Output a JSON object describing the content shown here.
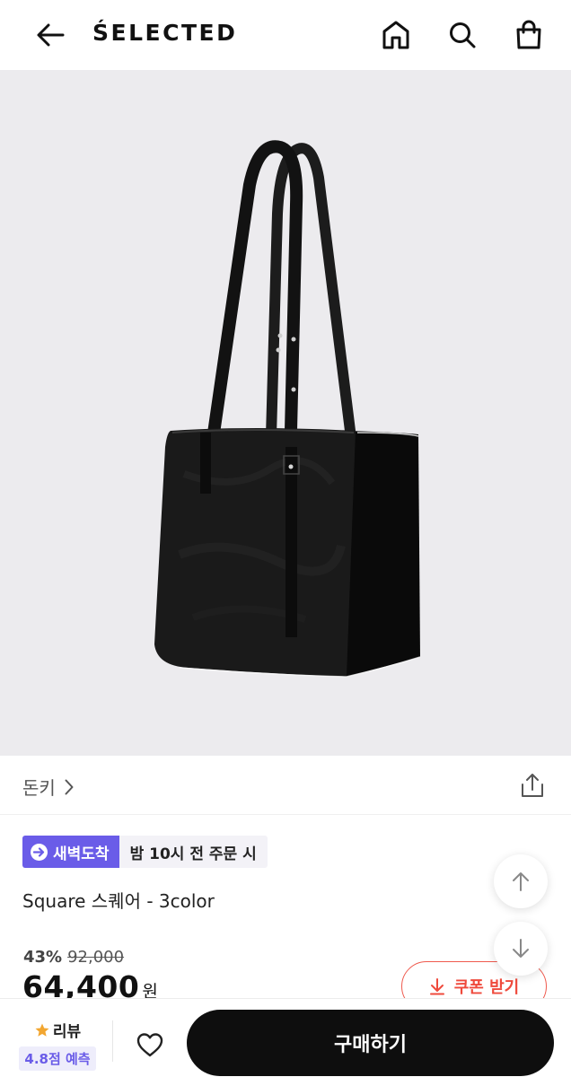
{
  "header": {
    "logo": "ŚELECTED",
    "icons": {
      "back": "arrow-left-icon",
      "home": "home-icon",
      "search": "search-icon",
      "bag": "shopping-bag-icon"
    }
  },
  "product": {
    "image": "black-leather-tote-bag",
    "brand": "돈키",
    "name": "Square 스퀘어 - 3color"
  },
  "delivery": {
    "badge": "새벽도착",
    "time": "밤 10시 전 주문 시"
  },
  "price": {
    "discount_rate": "43%",
    "original": "92,000",
    "sale": "64,400",
    "currency": "원"
  },
  "coupon": {
    "label": "쿠폰 받기"
  },
  "bottom": {
    "review_label": "리뷰",
    "rating": "4.8점 예측",
    "buy_label": "구매하기"
  },
  "colors": {
    "accent": "#6a5ce8",
    "coupon_red": "#ef4a3c",
    "buy_button": "#0e0e0e",
    "image_bg": "#ecebee"
  }
}
